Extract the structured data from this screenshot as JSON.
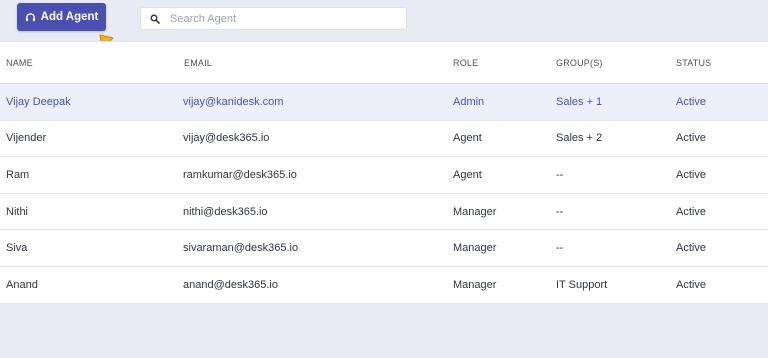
{
  "toolbar": {
    "add_agent_label": "Add Agent",
    "search_placeholder": "Search Agent",
    "search_value": ""
  },
  "columns": [
    "NAME",
    "EMAIL",
    "ROLE",
    "GROUP(S)",
    "STATUS"
  ],
  "rows": [
    {
      "name": "Vijay Deepak",
      "email": "vijay@kanidesk.com",
      "role": "Admin",
      "groups": "Sales + 1",
      "status": "Active"
    },
    {
      "name": "Vijender",
      "email": "vijay@desk365.io",
      "role": "Agent",
      "groups": "Sales + 2",
      "status": "Active"
    },
    {
      "name": "Ram",
      "email": "ramkumar@desk365.io",
      "role": "Agent",
      "groups": "--",
      "status": "Active"
    },
    {
      "name": "Nithi",
      "email": "nithi@desk365.io",
      "role": "Manager",
      "groups": "--",
      "status": "Active"
    },
    {
      "name": "Siva",
      "email": "sivaraman@desk365.io",
      "role": "Manager",
      "groups": "--",
      "status": "Active"
    },
    {
      "name": "Anand",
      "email": "anand@desk365.io",
      "role": "Manager",
      "groups": "IT Support",
      "status": "Active"
    }
  ],
  "colors": {
    "accent": "#4a4fb0",
    "selected_row_bg": "#eef0f9",
    "selected_row_text": "#4a50b5",
    "pointer_arrow": "#f2b01e"
  }
}
